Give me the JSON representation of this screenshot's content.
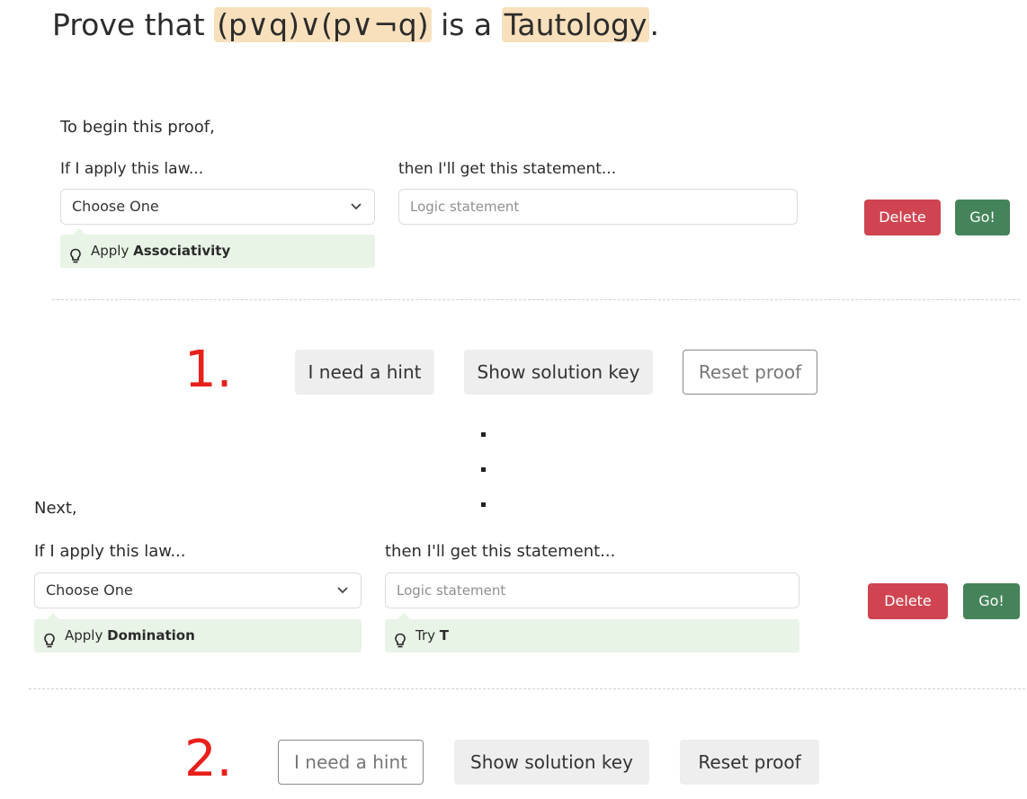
{
  "title": {
    "prefix": "Prove that ",
    "expression": "(p∨q)∨(p∨¬q)",
    "middle": " is a ",
    "target": "Tautology",
    "suffix": "."
  },
  "step1": {
    "intro": "To begin this proof,",
    "law_label": "If I apply this law...",
    "statement_label": "then I'll get this statement...",
    "law_select_value": "Choose One",
    "statement_placeholder": "Logic statement",
    "law_hint_prefix": "Apply ",
    "law_hint_value": "Associativity",
    "delete_label": "Delete",
    "go_label": "Go!"
  },
  "controls1": {
    "number": "1.",
    "hint_label": "I need a hint",
    "solution_label": "Show solution key",
    "reset_label": "Reset proof"
  },
  "step2": {
    "intro": "Next,",
    "law_label": "If I apply this law...",
    "statement_label": "then I'll get this statement...",
    "law_select_value": "Choose One",
    "statement_placeholder": "Logic statement",
    "law_hint_prefix": "Apply ",
    "law_hint_value": "Domination",
    "statement_hint_prefix": "Try ",
    "statement_hint_value": "T",
    "delete_label": "Delete",
    "go_label": "Go!"
  },
  "controls2": {
    "number": "2.",
    "hint_label": "I need a hint",
    "solution_label": "Show solution key",
    "reset_label": "Reset proof"
  },
  "icons": {
    "hint": "lightbulb-icon",
    "dropdown": "chevron-down-icon",
    "ellipsis": "vertical-ellipsis"
  },
  "colors": {
    "highlight": "#f8e0bc",
    "hint_background": "#e8f4e6",
    "delete": "#cf4450",
    "go": "#45845a",
    "number": "#e8201a"
  }
}
